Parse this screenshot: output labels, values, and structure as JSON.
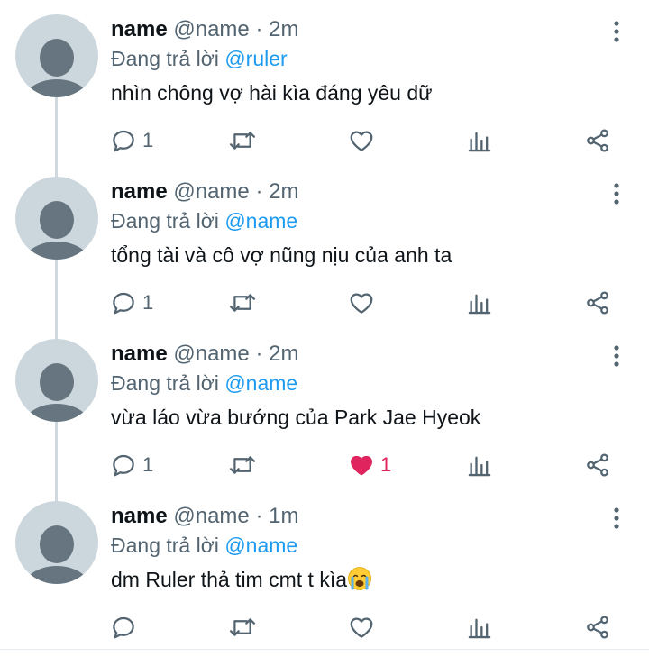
{
  "reply_prefix": "Đang trả lời",
  "tweets": [
    {
      "name": "name",
      "handle": "@name",
      "separator": "·",
      "time": "2m",
      "reply_to": "@ruler",
      "text": "nhìn chông vợ hài kìa đáng yêu dữ",
      "replies": "1",
      "retweets": "",
      "likes": "",
      "liked": false
    },
    {
      "name": "name",
      "handle": "@name",
      "separator": "·",
      "time": "2m",
      "reply_to": "@name",
      "text": "tổng tài và cô vợ nũng nịu của anh ta",
      "replies": "1",
      "retweets": "",
      "likes": "",
      "liked": false
    },
    {
      "name": "name",
      "handle": "@name",
      "separator": "·",
      "time": "2m",
      "reply_to": "@name",
      "text": "vừa láo vừa bướng của Park Jae Hyeok",
      "replies": "1",
      "retweets": "",
      "likes": "1",
      "liked": true
    },
    {
      "name": "name",
      "handle": "@name",
      "separator": "·",
      "time": "1m",
      "reply_to": "@name",
      "text": "dm Ruler thả tim cmt t kìa",
      "emoji": "loudly-crying-face",
      "replies": "",
      "retweets": "",
      "likes": "",
      "liked": false
    }
  ],
  "icons": {
    "reply": "reply-icon",
    "retweet": "retweet-icon",
    "like": "heart-icon",
    "analytics": "analytics-icon",
    "share": "share-icon",
    "more": "more-icon"
  },
  "colors": {
    "text": "#0f1419",
    "secondary": "#536471",
    "mention": "#1d9bf0",
    "like_active": "#e0245e",
    "thread_line": "#cfd9de",
    "avatar_bg": "#ccd6dd",
    "avatar_fg": "#66757f"
  }
}
